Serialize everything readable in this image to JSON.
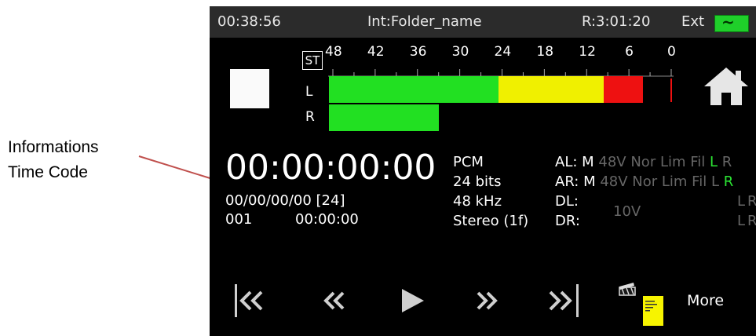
{
  "annotation": {
    "line1": "Informations",
    "line2": "Time Code"
  },
  "status_bar": {
    "elapsed": "00:38:56",
    "folder": "Int:Folder_name",
    "remaining": "R:3:01:20",
    "power_source": "Ext",
    "battery_symbol": "~"
  },
  "meters": {
    "st_label": "ST",
    "scale": [
      "48",
      "42",
      "36",
      "30",
      "24",
      "18",
      "12",
      "6",
      "0"
    ],
    "left_label": "L",
    "right_label": "R",
    "left_level_db": -4,
    "right_level_db": -33,
    "colors": {
      "green": "#22e022",
      "yellow": "#f0f000",
      "red": "#ee1111"
    }
  },
  "timecode": {
    "main": "00:00:00:00",
    "user_bits": "00/00/00/00 [24]",
    "take": "001",
    "take_time": "00:00:00"
  },
  "format": {
    "codec": "PCM",
    "bits": "24 bits",
    "rate": "48 kHz",
    "mode": "Stereo (1f)"
  },
  "channels": {
    "al": {
      "label": "AL:",
      "mode": "M",
      "flags": "48V Nor Lim Fil",
      "l": "L",
      "r": "R"
    },
    "ar": {
      "label": "AR:",
      "mode": "M",
      "flags": "48V Nor Lim Fil",
      "l": "L",
      "r": "R"
    },
    "dl": {
      "label": "DL:",
      "l": "L",
      "r": "R"
    },
    "dr": {
      "label": "DR:",
      "l": "L",
      "r": "R"
    },
    "dig_level": "10V"
  },
  "transport": {
    "prev": "prev-track",
    "rewind": "rewind",
    "play": "play",
    "forward": "fast-forward",
    "next": "next-track",
    "more": "More"
  }
}
